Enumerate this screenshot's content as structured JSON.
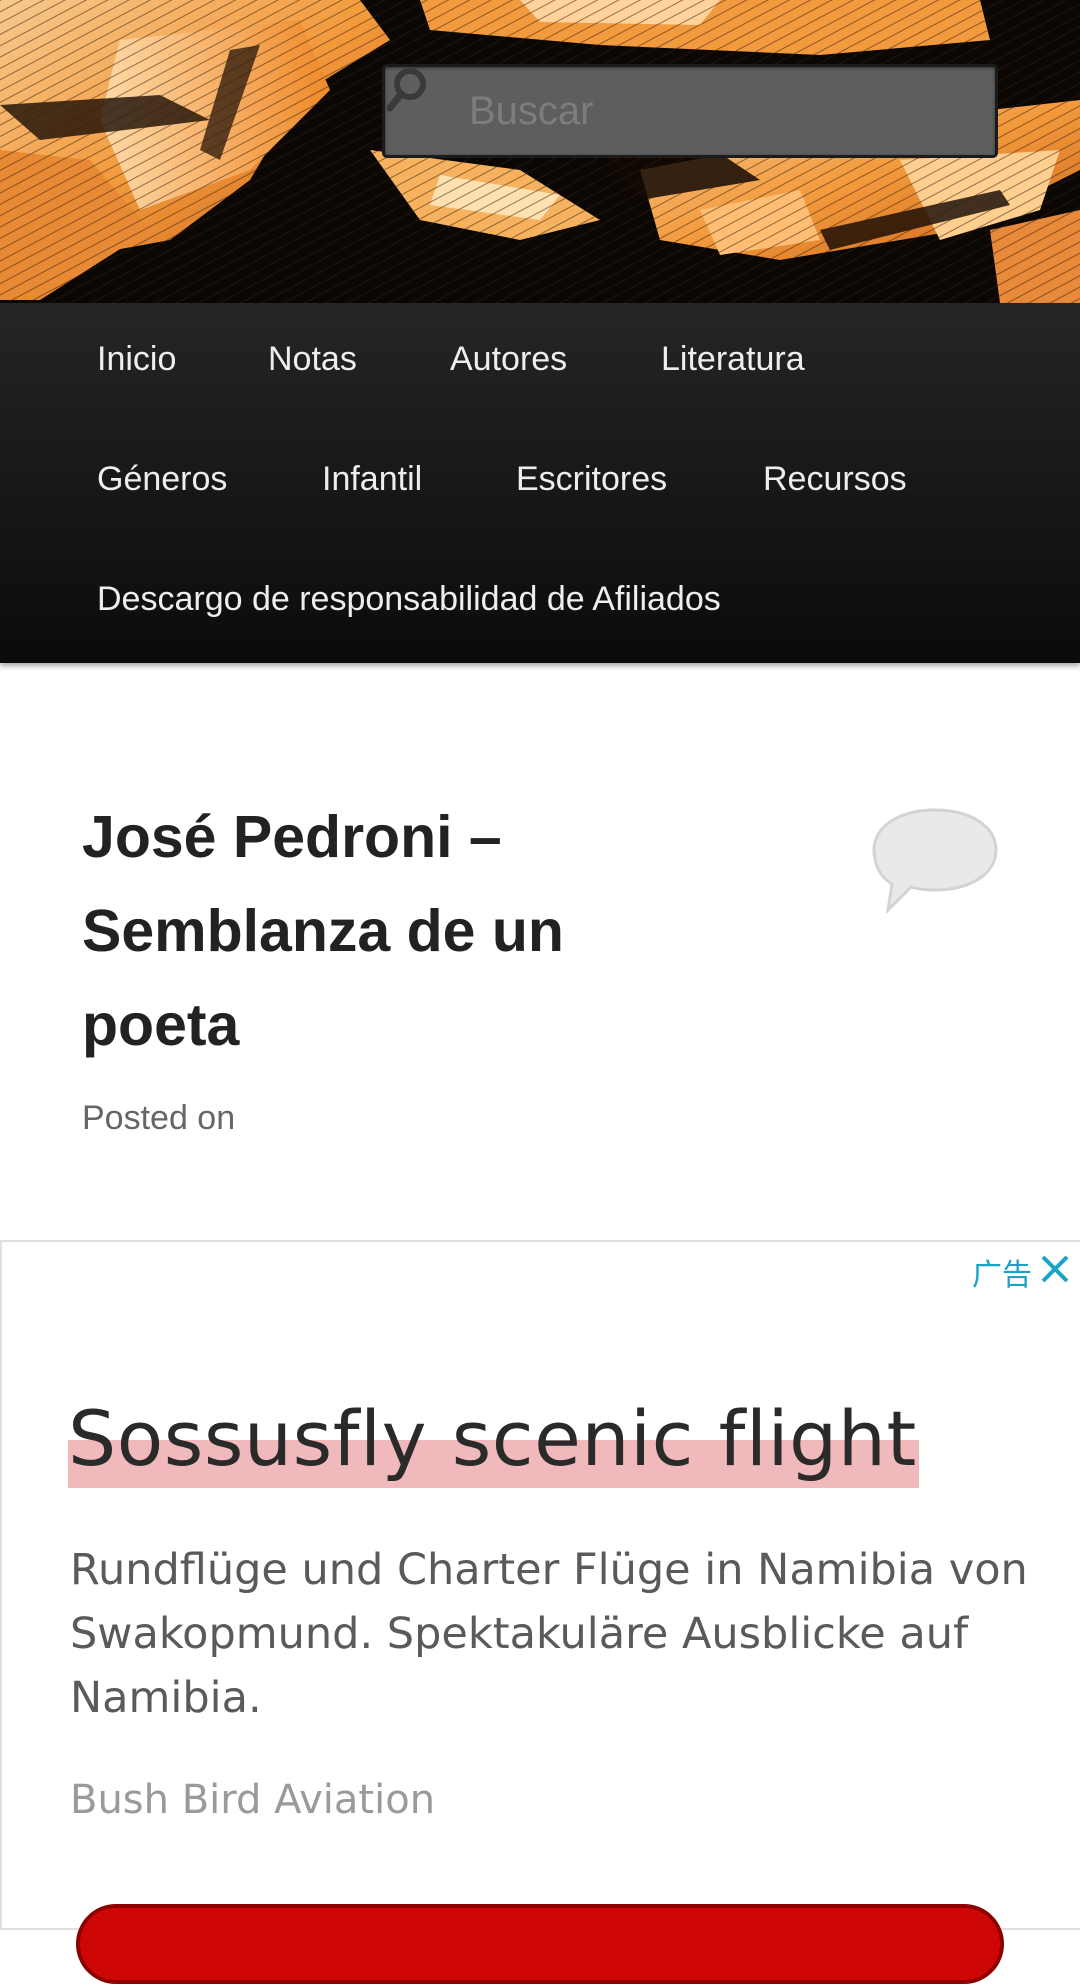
{
  "header": {
    "search": {
      "placeholder": "Buscar",
      "value": ""
    }
  },
  "nav": {
    "items": [
      {
        "label": "Inicio"
      },
      {
        "label": "Notas"
      },
      {
        "label": "Autores"
      },
      {
        "label": "Literatura"
      },
      {
        "label": "Géneros"
      },
      {
        "label": "Infantil"
      },
      {
        "label": "Escritores"
      },
      {
        "label": "Recursos"
      },
      {
        "label": "Descargo de responsabilidad de Afiliados"
      }
    ]
  },
  "article": {
    "title": "José Pedroni – Semblanza de un poeta",
    "posted_on": "Posted on"
  },
  "ad": {
    "label": "广告",
    "headline": "Sossusfly scenic flight",
    "body": "Rundflüge und Charter Flüge in Namibia von Swakopmund. Spektakuläre Ausblicke auf Namibia.",
    "advertiser": "Bush Bird Aviation"
  },
  "colors": {
    "nav_background": "#1a1a1a",
    "ad_accent": "#1aa3c6",
    "ad_headline_highlight": "#f0b9bb",
    "ad_cta": "#cf0606"
  }
}
